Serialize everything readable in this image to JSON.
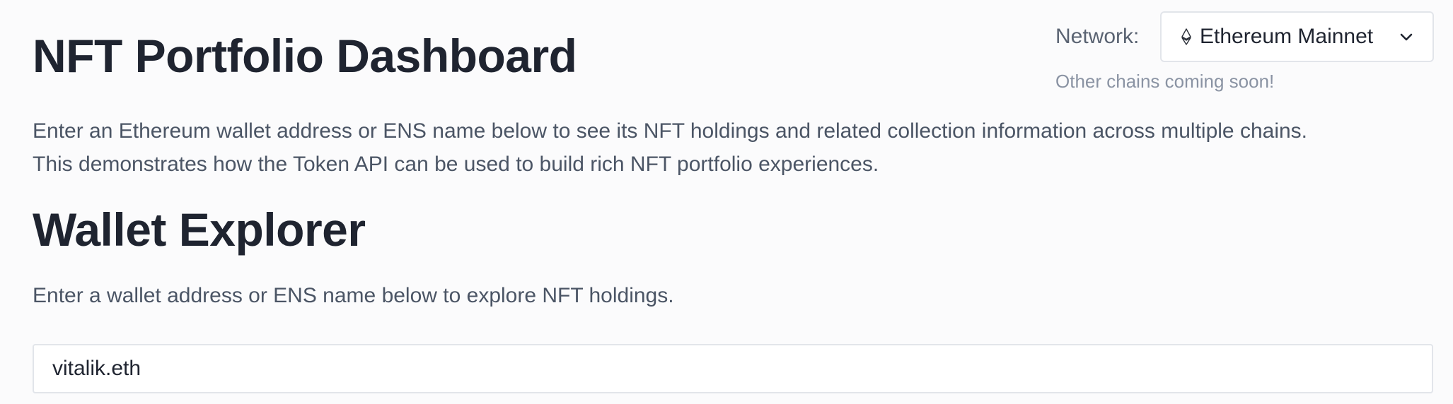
{
  "header": {
    "title": "NFT Portfolio Dashboard"
  },
  "network": {
    "label": "Network:",
    "selected": "Ethereum Mainnet",
    "icon": "ethereum-icon",
    "dropdown_icon": "chevron-down-icon",
    "note": "Other chains coming soon!"
  },
  "intro": {
    "line1": "Enter an Ethereum wallet address or ENS name below to see its NFT holdings and related collection information across multiple chains.",
    "line2": "This demonstrates how the Token API can be used to build rich NFT portfolio experiences."
  },
  "wallet_explorer": {
    "title": "Wallet Explorer",
    "description": "Enter a wallet address or ENS name below to explore NFT holdings.",
    "input_value": "vitalik.eth"
  }
}
